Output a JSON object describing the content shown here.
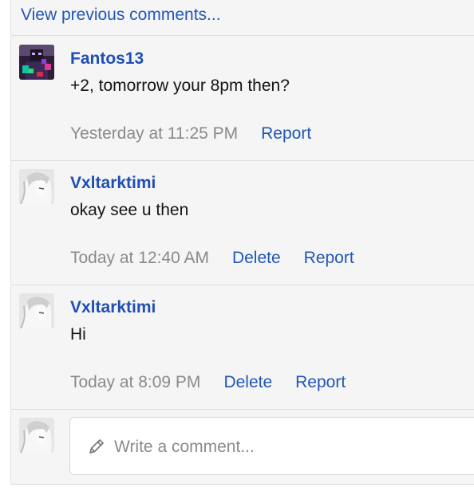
{
  "thread": {
    "view_previous_label": "View previous comments..."
  },
  "comments": [
    {
      "author": "Fantos13",
      "text": "+2, tomorrow your 8pm then?",
      "time": "Yesterday at 11:25 PM",
      "report_label": "Report"
    },
    {
      "author": "Vxltarktimi",
      "text": "okay see u then",
      "time": "Today at 12:40 AM",
      "delete_label": "Delete",
      "report_label": "Report"
    },
    {
      "author": "Vxltarktimi",
      "text": "Hi",
      "time": "Today at 8:09 PM",
      "delete_label": "Delete",
      "report_label": "Report"
    }
  ],
  "composer": {
    "placeholder": "Write a comment...",
    "icon": "pencil-icon"
  },
  "colors": {
    "link": "#2156b8",
    "author": "#1f4fb5",
    "muted": "#8a8a8a",
    "panel_bg": "#f5f5f5"
  }
}
